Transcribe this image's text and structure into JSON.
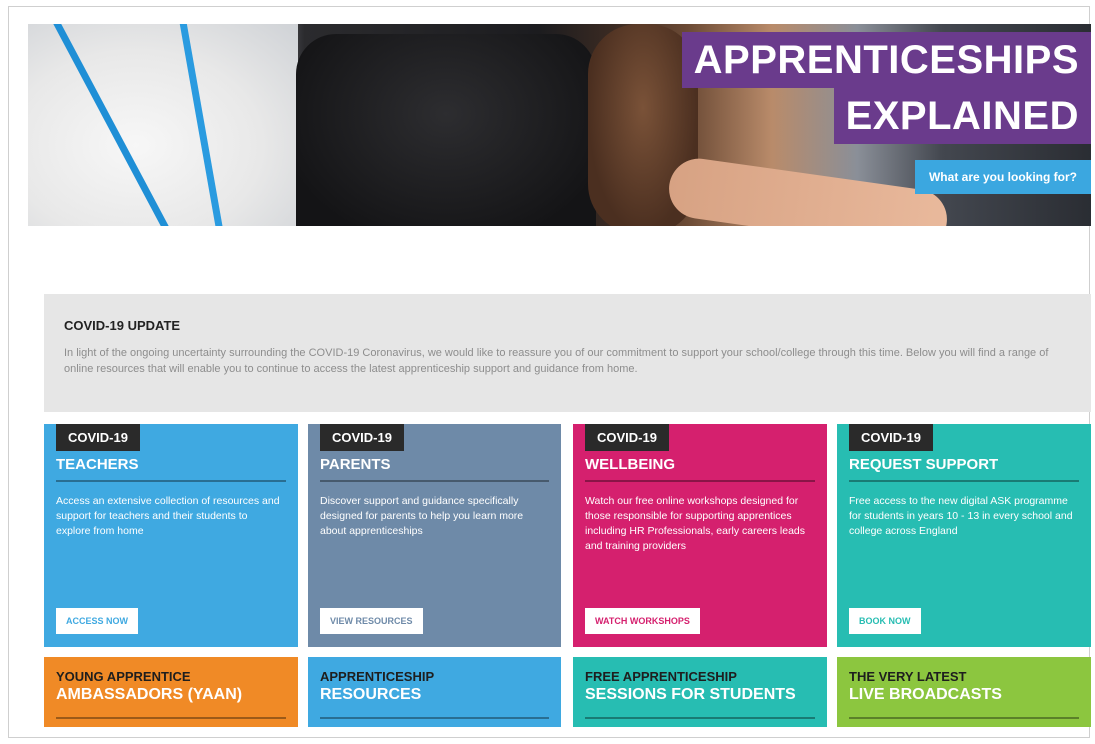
{
  "hero": {
    "title_line1": "APPRENTICESHIPS",
    "title_line2": "EXPLAINED",
    "cta_label": "What are you looking for?"
  },
  "update": {
    "heading": "COVID-19 UPDATE",
    "body": "In light of the ongoing uncertainty surrounding the COVID-19 Coronavirus, we would like to reassure you of our commitment to support your school/college through this time. Below you will find a range of online resources that will enable you to continue to access the latest apprenticeship support and guidance from home."
  },
  "cards": [
    {
      "badge": "COVID-19",
      "title": "TEACHERS",
      "description": "Access an extensive collection of resources and support for teachers and their students to explore from home",
      "button": "ACCESS NOW"
    },
    {
      "badge": "COVID-19",
      "title": "PARENTS",
      "description": "Discover support and guidance specifically designed for parents to help you learn more about apprenticeships",
      "button": "VIEW RESOURCES"
    },
    {
      "badge": "COVID-19",
      "title": "WELLBEING",
      "description": "Watch our free online workshops designed for those responsible for supporting apprentices including HR Professionals, early careers leads and training providers",
      "button": "WATCH WORKSHOPS"
    },
    {
      "badge": "COVID-19",
      "title": "REQUEST SUPPORT",
      "description": "Free access to the new digital ASK programme for students in years 10 - 13 in every school and college across England",
      "button": "BOOK NOW"
    }
  ],
  "tiles": [
    {
      "line1": "YOUNG APPRENTICE",
      "line2": "AMBASSADORS (YAAN)"
    },
    {
      "line1": "APPRENTICESHIP",
      "line2": "RESOURCES"
    },
    {
      "line1": "FREE APPRENTICESHIP",
      "line2": "SESSIONS FOR STUDENTS"
    },
    {
      "line1": "THE VERY LATEST",
      "line2": "LIVE BROADCASTS"
    }
  ],
  "colors": {
    "title_bg": "#6a3b8c",
    "cta_bg": "#3ba7e0",
    "teachers": "#3fa9e1",
    "parents": "#6e8aa8",
    "wellbeing": "#d5206e",
    "request_support": "#27bdb2",
    "yaan": "#f08a26",
    "resources": "#3fa9e1",
    "sessions": "#27bdb2",
    "broadcasts": "#8cc63f"
  }
}
